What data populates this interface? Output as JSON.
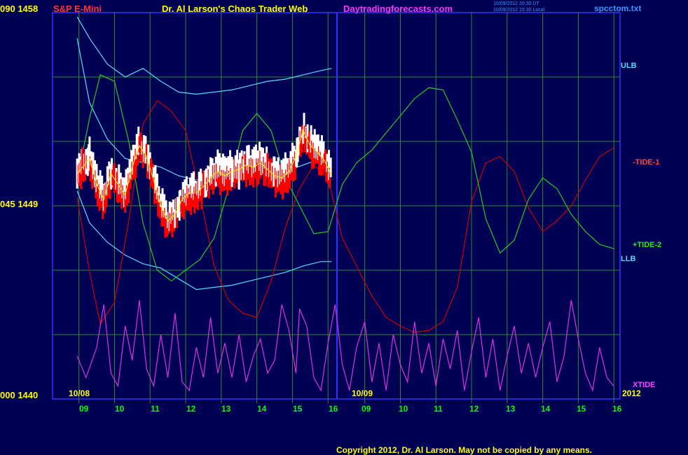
{
  "header": {
    "symbol": "S&P E-Mini",
    "author": "Dr. Al Larson's Chaos Trader Web",
    "site": "Daytradingforecasts.com",
    "time_ut": "10/09/2012 20:30 UT",
    "time_local": "10/09/2012 15:30 Local",
    "file": "spcctom.txt"
  },
  "y_left_labels": [
    {
      "osc": "090",
      "price": "1458"
    },
    {
      "osc": "045",
      "price": "1449"
    },
    {
      "osc": "000",
      "price": "1440"
    }
  ],
  "series_labels": {
    "ulb": "ULB",
    "tide1": "-TIDE-1",
    "tide2": "+TIDE-2",
    "llb": "LLB",
    "xtide": "XTIDE"
  },
  "date_labels": {
    "left": "10/08",
    "right": "10/09",
    "year": "2012"
  },
  "x_hours": [
    "09",
    "10",
    "11",
    "12",
    "13",
    "14",
    "15",
    "16",
    "09",
    "10",
    "11",
    "12",
    "13",
    "14",
    "15",
    "16"
  ],
  "copyright": "Copyright 2012, Dr. Al Larson. May not be copied by any means.",
  "colors": {
    "background": "#000055",
    "grid": "#2e8b2e",
    "divider": "#3333ff",
    "price_up": "#ffffff",
    "price_down": "#ff0000",
    "yellow": "#ffff00",
    "cyan": "#55ddff",
    "tide1": "#cc0000",
    "tide2": "#22cc22",
    "xtide": "#dd33dd"
  },
  "chart_data": {
    "type": "line",
    "title": "S&P E-Mini",
    "y_price_range": [
      1440,
      1458
    ],
    "y_osc_range": [
      0,
      90
    ],
    "x_sessions": [
      "10/08",
      "10/09"
    ],
    "price": {
      "name": "S&P E-Mini",
      "x": [
        8.95,
        9.1,
        9.3,
        9.5,
        9.7,
        9.9,
        10.1,
        10.3,
        10.5,
        10.7,
        10.9,
        11.1,
        11.3,
        11.5,
        11.7,
        11.9,
        12.1,
        12.3,
        12.5,
        12.7,
        12.9,
        13.1,
        13.3,
        13.5,
        13.7,
        13.9,
        14.1,
        14.3,
        14.5,
        14.7,
        14.9,
        15.1,
        15.3,
        15.5,
        15.7,
        15.9,
        16.1
      ],
      "y": [
        1450.5,
        1450.8,
        1451.2,
        1450.0,
        1449.3,
        1450.5,
        1450.0,
        1449.5,
        1450.8,
        1451.8,
        1451.3,
        1450.2,
        1449.0,
        1448.3,
        1448.6,
        1449.3,
        1449.6,
        1449.6,
        1449.9,
        1450.3,
        1450.6,
        1450.4,
        1450.6,
        1450.7,
        1450.9,
        1450.8,
        1451.0,
        1450.7,
        1450.4,
        1450.3,
        1450.6,
        1451.3,
        1452.5,
        1451.8,
        1451.5,
        1451.1,
        1450.4
      ]
    },
    "series": [
      {
        "name": "ULB",
        "x": [
          8.95,
          9.3,
          9.8,
          10.3,
          10.8,
          11.3,
          11.8,
          12.3,
          12.8,
          13.3,
          13.8,
          14.3,
          14.8,
          15.3,
          15.8,
          16.1
        ],
        "y": [
          1457.8,
          1456.8,
          1455.6,
          1455.0,
          1455.4,
          1454.8,
          1454.3,
          1454.2,
          1454.3,
          1454.4,
          1454.6,
          1454.8,
          1454.9,
          1455.1,
          1455.3,
          1455.4
        ]
      },
      {
        "name": "LLB",
        "x": [
          8.95,
          9.3,
          9.8,
          10.3,
          10.8,
          11.3,
          11.8,
          12.3,
          12.8,
          13.3,
          13.8,
          14.3,
          14.8,
          15.3,
          15.8,
          16.1
        ],
        "y": [
          1449.7,
          1448.2,
          1447.3,
          1446.7,
          1446.3,
          1446.1,
          1445.6,
          1445.1,
          1445.2,
          1445.3,
          1445.5,
          1445.7,
          1445.9,
          1446.2,
          1446.4,
          1446.4
        ]
      },
      {
        "name": "ULB-middle",
        "x": [
          8.95,
          9.3,
          9.8,
          10.3,
          10.8,
          11.3,
          11.8,
          12.3,
          12.8,
          13.3,
          13.8,
          14.3,
          14.8,
          15.3,
          15.8,
          16.1
        ],
        "y": [
          1456.8,
          1453.8,
          1452.1,
          1451.2,
          1451.0,
          1450.8,
          1450.4,
          1450.2,
          1450.3,
          1450.4,
          1450.6,
          1450.7,
          1450.6,
          1450.9,
          1451.2,
          1451.0
        ]
      },
      {
        "name": "-TIDE-1",
        "x": [
          8.95,
          9.3,
          9.6,
          10.0,
          10.4,
          10.8,
          11.2,
          11.6,
          12.0,
          12.4,
          12.8,
          13.2,
          13.6,
          14.0,
          14.4,
          14.8,
          15.2,
          15.6,
          16.0,
          16.4,
          16.8,
          17.2,
          17.6,
          18.0,
          18.4,
          18.8,
          19.2,
          19.6,
          20.0,
          20.4,
          20.8,
          21.2,
          21.6,
          22.0,
          22.4,
          22.8,
          23.2,
          23.6,
          24.0
        ],
        "y": [
          1449.4,
          1445.9,
          1443.5,
          1444.5,
          1448.3,
          1452.8,
          1453.9,
          1453.4,
          1452.5,
          1449.5,
          1446.2,
          1444.6,
          1444.0,
          1443.8,
          1445.5,
          1448.0,
          1449.8,
          1450.9,
          1450.3,
          1447.5,
          1446.2,
          1444.8,
          1443.8,
          1443.4,
          1443.1,
          1443.2,
          1443.6,
          1445.2,
          1449.2,
          1451.0,
          1451.3,
          1450.6,
          1448.9,
          1447.8,
          1448.3,
          1449.0,
          1450.2,
          1451.3,
          1451.7
        ]
      },
      {
        "name": "+TIDE-2",
        "x": [
          8.95,
          9.3,
          9.6,
          10.0,
          10.4,
          10.8,
          11.2,
          11.6,
          12.0,
          12.4,
          12.8,
          13.2,
          13.6,
          14.0,
          14.4,
          14.8,
          15.2,
          15.6,
          16.0,
          16.4,
          16.8,
          17.2,
          17.6,
          18.0,
          18.4,
          18.8,
          19.2,
          19.6,
          20.0,
          20.4,
          20.8,
          21.2,
          21.6,
          22.0,
          22.4,
          22.8,
          23.2,
          23.6,
          24.0
        ],
        "y": [
          1450.2,
          1453.1,
          1455.1,
          1454.8,
          1452.0,
          1448.2,
          1446.0,
          1445.5,
          1446.0,
          1446.5,
          1447.5,
          1449.8,
          1452.5,
          1453.3,
          1452.5,
          1450.3,
          1449.0,
          1447.7,
          1447.8,
          1450.0,
          1451.0,
          1451.6,
          1452.4,
          1453.2,
          1454.0,
          1454.5,
          1454.4,
          1453.0,
          1451.5,
          1448.4,
          1446.8,
          1447.4,
          1449.3,
          1450.3,
          1449.8,
          1448.6,
          1447.8,
          1447.2,
          1447.0
        ]
      },
      {
        "name": "XTIDE",
        "x": [
          8.95,
          9.2,
          9.5,
          9.7,
          9.9,
          10.1,
          10.3,
          10.5,
          10.7,
          10.9,
          11.1,
          11.3,
          11.5,
          11.7,
          11.9,
          12.1,
          12.3,
          12.5,
          12.7,
          12.9,
          13.1,
          13.3,
          13.5,
          13.7,
          13.9,
          14.1,
          14.3,
          14.5,
          14.7,
          14.9,
          15.1,
          15.2,
          15.4,
          15.6,
          15.8,
          16.0,
          16.2,
          16.4,
          16.6,
          16.8,
          17.0,
          17.2,
          17.4,
          17.6,
          17.8,
          18.0,
          18.2,
          18.4,
          18.6,
          18.8,
          19.0,
          19.2,
          19.4,
          19.6,
          19.8,
          20.0,
          20.2,
          20.4,
          20.6,
          20.8,
          21.0,
          21.2,
          21.4,
          21.6,
          21.8,
          22.0,
          22.2,
          22.4,
          22.6,
          22.8,
          23.0,
          23.2,
          23.4,
          23.6,
          23.8,
          24.0
        ],
        "y": [
          10,
          5,
          12,
          22,
          6,
          3,
          17,
          9,
          23,
          7,
          3,
          15,
          5,
          20,
          4,
          2,
          12,
          5,
          19,
          6,
          13,
          5,
          15,
          4,
          10,
          14,
          6,
          9,
          22,
          16,
          6,
          21,
          17,
          5,
          2,
          13,
          22,
          8,
          2,
          12,
          18,
          4,
          13,
          2,
          15,
          8,
          4,
          18,
          6,
          13,
          3,
          14,
          7,
          16,
          2,
          11,
          19,
          5,
          14,
          2,
          10,
          17,
          6,
          13,
          5,
          12,
          18,
          4,
          10,
          23,
          14,
          6,
          2,
          12,
          5,
          3
        ]
      }
    ]
  }
}
